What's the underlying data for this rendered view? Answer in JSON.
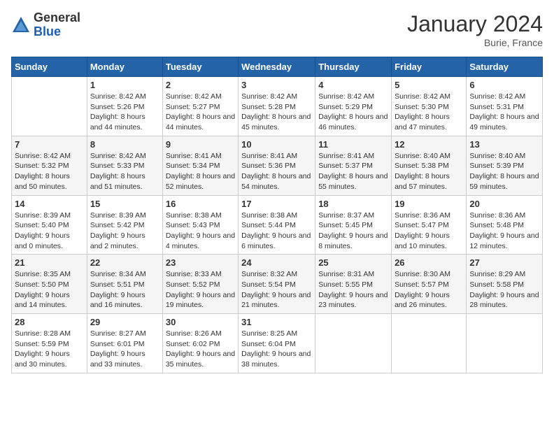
{
  "header": {
    "logo_general": "General",
    "logo_blue": "Blue",
    "title": "January 2024",
    "location": "Burie, France"
  },
  "weekdays": [
    "Sunday",
    "Monday",
    "Tuesday",
    "Wednesday",
    "Thursday",
    "Friday",
    "Saturday"
  ],
  "weeks": [
    [
      {
        "day": "",
        "sunrise": "",
        "sunset": "",
        "daylight": ""
      },
      {
        "day": "1",
        "sunrise": "Sunrise: 8:42 AM",
        "sunset": "Sunset: 5:26 PM",
        "daylight": "Daylight: 8 hours and 44 minutes."
      },
      {
        "day": "2",
        "sunrise": "Sunrise: 8:42 AM",
        "sunset": "Sunset: 5:27 PM",
        "daylight": "Daylight: 8 hours and 44 minutes."
      },
      {
        "day": "3",
        "sunrise": "Sunrise: 8:42 AM",
        "sunset": "Sunset: 5:28 PM",
        "daylight": "Daylight: 8 hours and 45 minutes."
      },
      {
        "day": "4",
        "sunrise": "Sunrise: 8:42 AM",
        "sunset": "Sunset: 5:29 PM",
        "daylight": "Daylight: 8 hours and 46 minutes."
      },
      {
        "day": "5",
        "sunrise": "Sunrise: 8:42 AM",
        "sunset": "Sunset: 5:30 PM",
        "daylight": "Daylight: 8 hours and 47 minutes."
      },
      {
        "day": "6",
        "sunrise": "Sunrise: 8:42 AM",
        "sunset": "Sunset: 5:31 PM",
        "daylight": "Daylight: 8 hours and 49 minutes."
      }
    ],
    [
      {
        "day": "7",
        "sunrise": "Sunrise: 8:42 AM",
        "sunset": "Sunset: 5:32 PM",
        "daylight": "Daylight: 8 hours and 50 minutes."
      },
      {
        "day": "8",
        "sunrise": "Sunrise: 8:42 AM",
        "sunset": "Sunset: 5:33 PM",
        "daylight": "Daylight: 8 hours and 51 minutes."
      },
      {
        "day": "9",
        "sunrise": "Sunrise: 8:41 AM",
        "sunset": "Sunset: 5:34 PM",
        "daylight": "Daylight: 8 hours and 52 minutes."
      },
      {
        "day": "10",
        "sunrise": "Sunrise: 8:41 AM",
        "sunset": "Sunset: 5:36 PM",
        "daylight": "Daylight: 8 hours and 54 minutes."
      },
      {
        "day": "11",
        "sunrise": "Sunrise: 8:41 AM",
        "sunset": "Sunset: 5:37 PM",
        "daylight": "Daylight: 8 hours and 55 minutes."
      },
      {
        "day": "12",
        "sunrise": "Sunrise: 8:40 AM",
        "sunset": "Sunset: 5:38 PM",
        "daylight": "Daylight: 8 hours and 57 minutes."
      },
      {
        "day": "13",
        "sunrise": "Sunrise: 8:40 AM",
        "sunset": "Sunset: 5:39 PM",
        "daylight": "Daylight: 8 hours and 59 minutes."
      }
    ],
    [
      {
        "day": "14",
        "sunrise": "Sunrise: 8:39 AM",
        "sunset": "Sunset: 5:40 PM",
        "daylight": "Daylight: 9 hours and 0 minutes."
      },
      {
        "day": "15",
        "sunrise": "Sunrise: 8:39 AM",
        "sunset": "Sunset: 5:42 PM",
        "daylight": "Daylight: 9 hours and 2 minutes."
      },
      {
        "day": "16",
        "sunrise": "Sunrise: 8:38 AM",
        "sunset": "Sunset: 5:43 PM",
        "daylight": "Daylight: 9 hours and 4 minutes."
      },
      {
        "day": "17",
        "sunrise": "Sunrise: 8:38 AM",
        "sunset": "Sunset: 5:44 PM",
        "daylight": "Daylight: 9 hours and 6 minutes."
      },
      {
        "day": "18",
        "sunrise": "Sunrise: 8:37 AM",
        "sunset": "Sunset: 5:45 PM",
        "daylight": "Daylight: 9 hours and 8 minutes."
      },
      {
        "day": "19",
        "sunrise": "Sunrise: 8:36 AM",
        "sunset": "Sunset: 5:47 PM",
        "daylight": "Daylight: 9 hours and 10 minutes."
      },
      {
        "day": "20",
        "sunrise": "Sunrise: 8:36 AM",
        "sunset": "Sunset: 5:48 PM",
        "daylight": "Daylight: 9 hours and 12 minutes."
      }
    ],
    [
      {
        "day": "21",
        "sunrise": "Sunrise: 8:35 AM",
        "sunset": "Sunset: 5:50 PM",
        "daylight": "Daylight: 9 hours and 14 minutes."
      },
      {
        "day": "22",
        "sunrise": "Sunrise: 8:34 AM",
        "sunset": "Sunset: 5:51 PM",
        "daylight": "Daylight: 9 hours and 16 minutes."
      },
      {
        "day": "23",
        "sunrise": "Sunrise: 8:33 AM",
        "sunset": "Sunset: 5:52 PM",
        "daylight": "Daylight: 9 hours and 19 minutes."
      },
      {
        "day": "24",
        "sunrise": "Sunrise: 8:32 AM",
        "sunset": "Sunset: 5:54 PM",
        "daylight": "Daylight: 9 hours and 21 minutes."
      },
      {
        "day": "25",
        "sunrise": "Sunrise: 8:31 AM",
        "sunset": "Sunset: 5:55 PM",
        "daylight": "Daylight: 9 hours and 23 minutes."
      },
      {
        "day": "26",
        "sunrise": "Sunrise: 8:30 AM",
        "sunset": "Sunset: 5:57 PM",
        "daylight": "Daylight: 9 hours and 26 minutes."
      },
      {
        "day": "27",
        "sunrise": "Sunrise: 8:29 AM",
        "sunset": "Sunset: 5:58 PM",
        "daylight": "Daylight: 9 hours and 28 minutes."
      }
    ],
    [
      {
        "day": "28",
        "sunrise": "Sunrise: 8:28 AM",
        "sunset": "Sunset: 5:59 PM",
        "daylight": "Daylight: 9 hours and 30 minutes."
      },
      {
        "day": "29",
        "sunrise": "Sunrise: 8:27 AM",
        "sunset": "Sunset: 6:01 PM",
        "daylight": "Daylight: 9 hours and 33 minutes."
      },
      {
        "day": "30",
        "sunrise": "Sunrise: 8:26 AM",
        "sunset": "Sunset: 6:02 PM",
        "daylight": "Daylight: 9 hours and 35 minutes."
      },
      {
        "day": "31",
        "sunrise": "Sunrise: 8:25 AM",
        "sunset": "Sunset: 6:04 PM",
        "daylight": "Daylight: 9 hours and 38 minutes."
      },
      {
        "day": "",
        "sunrise": "",
        "sunset": "",
        "daylight": ""
      },
      {
        "day": "",
        "sunrise": "",
        "sunset": "",
        "daylight": ""
      },
      {
        "day": "",
        "sunrise": "",
        "sunset": "",
        "daylight": ""
      }
    ]
  ]
}
